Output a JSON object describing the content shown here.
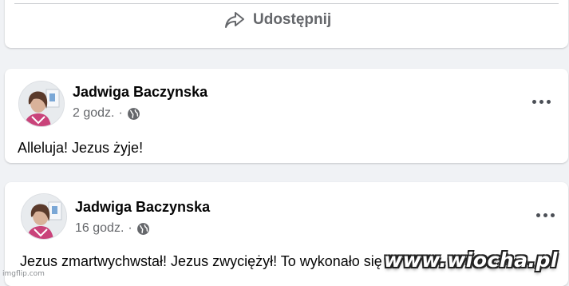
{
  "top_card": {
    "share_label": "Udostępnij"
  },
  "posts": [
    {
      "author": "Jadwiga Baczynska",
      "time": "2 godz.",
      "separator": "·",
      "text": "Alleluja! Jezus żyje!"
    },
    {
      "author": "Jadwiga Baczynska",
      "time": "16 godz.",
      "separator": "·",
      "text": "Jezus zmartwychwstał! Jezus zwyciężył! To wykonało się"
    }
  ],
  "watermarks": {
    "site": "www.wiocha.pl",
    "generator": "imgflip.com"
  },
  "icons": {
    "share": "share-icon",
    "audience": "globe-icon",
    "more": "more-options-icon"
  },
  "colors": {
    "background": "#f0f2f5",
    "card": "#ffffff",
    "secondary_text": "#65676b"
  }
}
